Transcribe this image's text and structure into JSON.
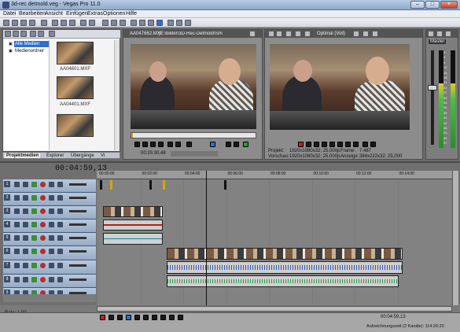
{
  "window": {
    "title": "3d-rec detmold.veg - Vegas Pro 11.0"
  },
  "menu": [
    "Datei",
    "Bearbeiten",
    "Ansicht",
    "Einfügen",
    "Extras",
    "Optionen",
    "Hilfe"
  ],
  "explorer": {
    "tree": [
      "Alle Medien",
      "Medienordner"
    ],
    "media": [
      "AA04601.MXF",
      "AA04401.MXF",
      ""
    ],
    "tabs": [
      "Projektmedien",
      "Explorer",
      "Übergänge",
      "Vi"
    ]
  },
  "trimmer": {
    "file": "AA047662.MXF",
    "path": "[E:\\bilder\\3D-Rec-Detmold\\Sm",
    "timecode": "00:25:30,48"
  },
  "preview": {
    "mode": "Optimal (Voll)",
    "labels": [
      "Projekt:",
      "Vorschau:",
      "Frame:",
      "Anzeige:"
    ],
    "values": [
      "1920x1080x32; 25,000p",
      "1920x1080x32; 25,000p",
      "7.487",
      "384x222x32; 25,000"
    ]
  },
  "mixer": {
    "title": "Master",
    "scale": [
      "3",
      "6",
      "9",
      "12",
      "15",
      "18",
      "21",
      "24",
      "27",
      "30",
      "33",
      "36",
      "39",
      "42",
      "45",
      "48",
      "51",
      "54",
      "57"
    ],
    "levels": [
      0.66,
      0.66
    ]
  },
  "timeline": {
    "timecode": "00:04:59,13",
    "ruler": [
      "00:00:00",
      "00:02:00",
      "00:04:00",
      "00:06:00",
      "00:08:00",
      "00:10:00",
      "00:12:00",
      "00:14:00"
    ],
    "tracks": [
      {
        "num": "1",
        "type": "video"
      },
      {
        "num": "2",
        "type": "video"
      },
      {
        "num": "3",
        "type": "video"
      },
      {
        "num": "4",
        "type": "audio"
      },
      {
        "num": "5",
        "type": "audio"
      },
      {
        "num": "6",
        "type": "video"
      },
      {
        "num": "7",
        "type": "audio"
      },
      {
        "num": "8",
        "type": "audio"
      },
      {
        "num": "9",
        "type": "video"
      }
    ],
    "rate": "Rate: 1,00"
  },
  "status": {
    "time": "00:04:59,13",
    "record": "Aufzeichnungszeit (2 Kanäle): 114:26:20"
  },
  "colors": {
    "panel": "#8c8c8c",
    "track_header": "#a9bbd3",
    "accent": "#2f6fc9"
  }
}
